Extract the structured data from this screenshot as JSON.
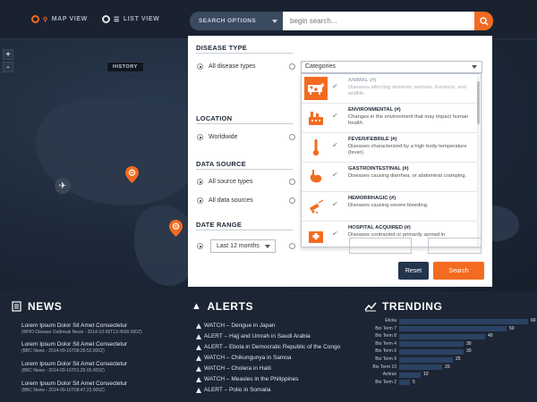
{
  "topbar": {
    "map_view": "MAP VIEW",
    "list_view": "LIST VIEW",
    "search_options": "SEARCH OPTIONS",
    "search_placeholder": "begin search...",
    "history_label": "HISTORY"
  },
  "zoom": {
    "in": "+",
    "out": "-"
  },
  "panel": {
    "disease_type": {
      "title": "DISEASE TYPE",
      "all_label": "All disease types",
      "categories_placeholder": "Categories",
      "items": [
        {
          "name": "ANIMAL (#)",
          "desc": "Diseases affecting domestic animals, livestock, and wildlife.",
          "icon": "cow-icon",
          "selected": true
        },
        {
          "name": "ENVIRONMENTAL (#)",
          "desc": "Changes in the environment that may impact human health.",
          "icon": "factory-icon",
          "selected": false
        },
        {
          "name": "FEVER/FEBRILE (#)",
          "desc": "Diseases characterized by a high body temperature (fever).",
          "icon": "thermometer-icon",
          "selected": false
        },
        {
          "name": "GASTROINTESTINAL (#)",
          "desc": "Diseases causing diarrhea, or abdominal cramping.",
          "icon": "stomach-icon",
          "selected": false
        },
        {
          "name": "HEMORRHAGIC (#)",
          "desc": "Diseases causing severe bleeding.",
          "icon": "syringe-icon",
          "selected": false
        },
        {
          "name": "HOSPITAL ACQUIRED (#)",
          "desc": "Diseases contracted or primarily spread in",
          "icon": "hospital-icon",
          "selected": false
        }
      ]
    },
    "location": {
      "title": "LOCATION",
      "worldwide": "Worldwide"
    },
    "data_source": {
      "title": "DATA SOURCE",
      "all_types": "All source types",
      "all_data": "All data sources"
    },
    "date_range": {
      "title": "DATE RANGE",
      "value": "Last 12 months"
    },
    "reset": "Reset",
    "search": "Search"
  },
  "news": {
    "title": "NEWS",
    "items": [
      {
        "title": "Lorem Ipsum Dolor Sit Amet Consectetur",
        "meta": "(WHO Disease Outbreak News - 2014-10-09T13:4500.000Z)"
      },
      {
        "title": "Lorem Ipsum Dolor Sit Amet Consectetur",
        "meta": "(BBC News - 2014-09-16T08:29:52.000Z)"
      },
      {
        "title": "Lorem Ipsum Dolor Sit Amet Consectetur",
        "meta": "(BBC News - 2014-09-16T01:25:05.000Z)"
      },
      {
        "title": "Lorem Ipsum Dolor Sit Amet Consectetur",
        "meta": "(BBC News - 2014-09-16T08:47:23.000Z)"
      }
    ]
  },
  "alerts": {
    "title": "ALERTS",
    "items": [
      "WATCH – Dengue in Japan",
      "ALERT – Hajj and Umrah in Saudi Arabia",
      "ALERT – Ebola in Democratic Republic of the Congo",
      "WATCH – Chikungunya in Samoa",
      "WATCH – Cholera in Haiti",
      "WATCH – Measles in the Philippines",
      "ALERT – Polio in Somalia"
    ]
  },
  "trending": {
    "title": "TRENDING",
    "items": [
      {
        "label": "Ebola",
        "value": 60
      },
      {
        "label": "Bio Term 7",
        "value": 50
      },
      {
        "label": "Bio Term 8",
        "value": 40
      },
      {
        "label": "Bio Term 4",
        "value": 30
      },
      {
        "label": "Bio Term 6",
        "value": 30
      },
      {
        "label": "Bio Term 9",
        "value": 25
      },
      {
        "label": "Bio Term 10",
        "value": 20
      },
      {
        "label": "Avitrax",
        "value": 10
      },
      {
        "label": "Bio Term 2",
        "value": 5
      }
    ]
  },
  "colors": {
    "accent": "#f36b21",
    "navy": "#23344d"
  }
}
